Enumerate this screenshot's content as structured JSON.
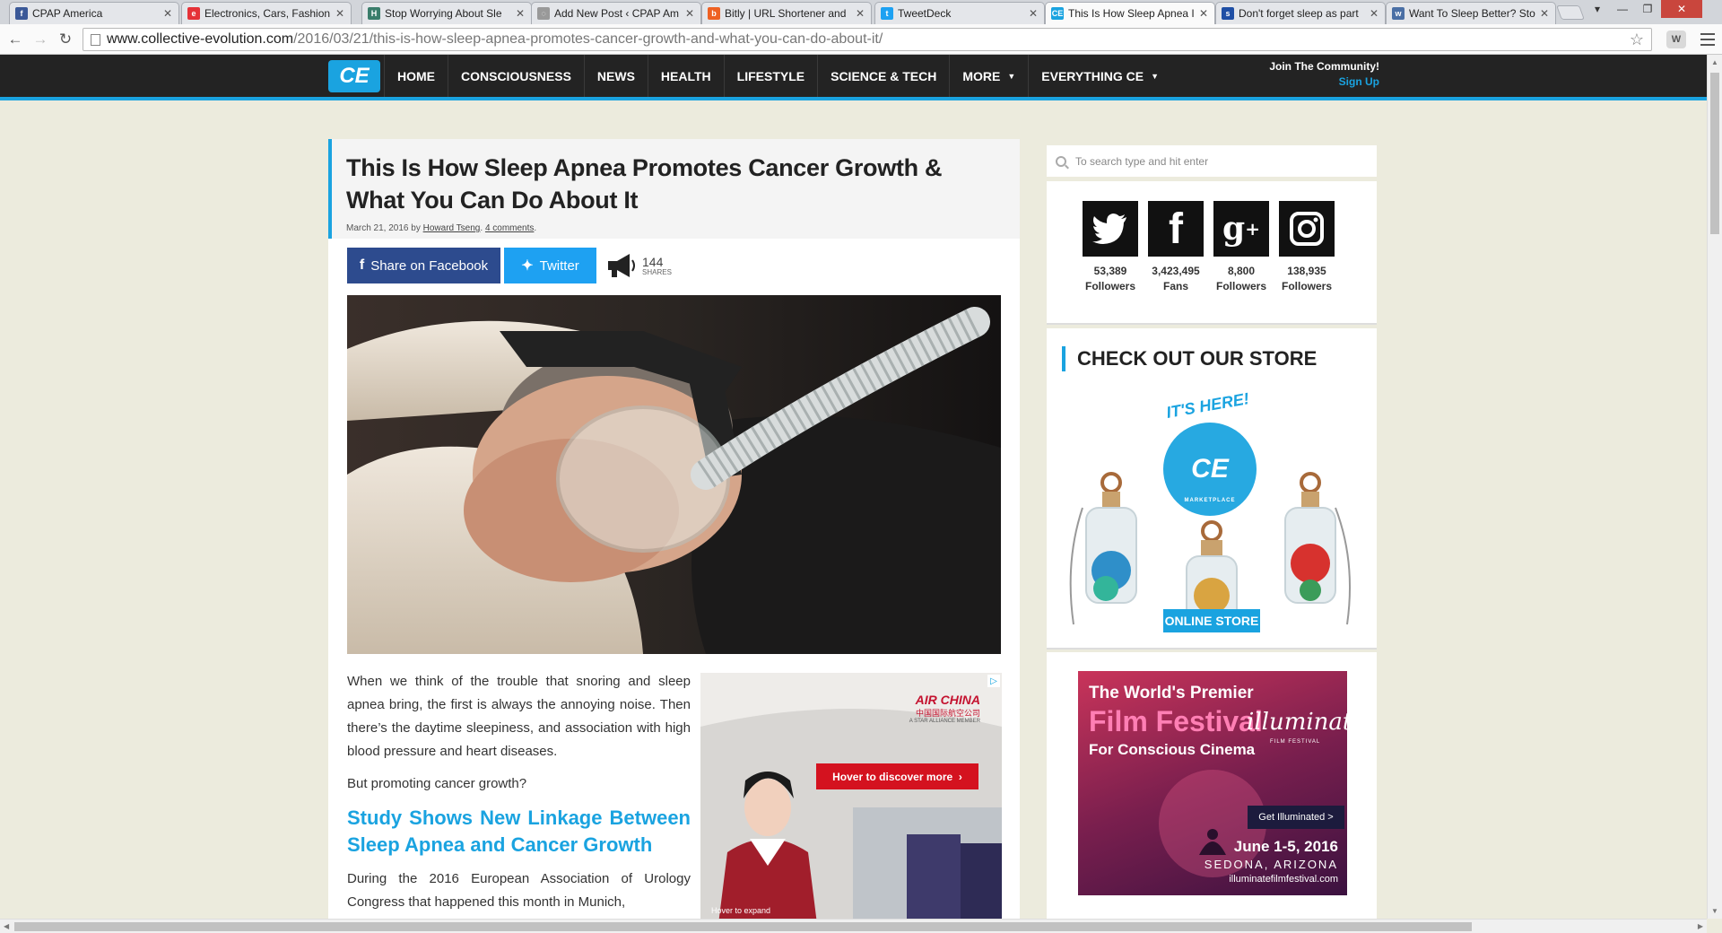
{
  "browser": {
    "tabs": [
      {
        "title": "CPAP America",
        "favicon": "facebook-favicon",
        "color": "#3b5998",
        "glyph": "f"
      },
      {
        "title": "Electronics, Cars, Fashion,",
        "favicon": "ebay-favicon",
        "color": "#e53238",
        "glyph": "e"
      },
      {
        "title": "Stop Worrying About Sle",
        "favicon": "h-favicon",
        "color": "#3a7d6b",
        "glyph": "H"
      },
      {
        "title": "Add New Post ‹ CPAP Am",
        "favicon": "loading-favicon",
        "color": "#999999",
        "glyph": "◌"
      },
      {
        "title": "Bitly | URL Shortener and",
        "favicon": "bitly-favicon",
        "color": "#ee6123",
        "glyph": "b"
      },
      {
        "title": "TweetDeck",
        "favicon": "tweetdeck-favicon",
        "color": "#1da1f2",
        "glyph": "t"
      },
      {
        "title": "This Is How Sleep Apnea I",
        "favicon": "ce-favicon",
        "color": "#1aa3e0",
        "glyph": "CE"
      },
      {
        "title": "Don't forget sleep as part",
        "favicon": "site-favicon",
        "color": "#1f4fa5",
        "glyph": "s"
      },
      {
        "title": "Want To Sleep Better? Sto",
        "favicon": "site2-favicon",
        "color": "#4a6fa5",
        "glyph": "w"
      }
    ],
    "active_tab": 6,
    "url_domain": "www.collective-evolution.com",
    "url_path": "/2016/03/21/this-is-how-sleep-apnea-promotes-cancer-growth-and-what-you-can-do-about-it/",
    "extension_label": "W"
  },
  "site": {
    "logo_text": "CE",
    "nav": [
      "HOME",
      "CONSCIOUSNESS",
      "NEWS",
      "HEALTH",
      "LIFESTYLE",
      "SCIENCE & TECH",
      "MORE",
      "EVERYTHING CE"
    ],
    "join": "Join The Community!",
    "signup": "Sign Up",
    "accent": "#1aa3e0"
  },
  "article": {
    "title": "This Is How Sleep Apnea Promotes Cancer Growth & What You Can Do About It",
    "date": "March 21, 2016",
    "by": "by",
    "author": "Howard Tseng",
    "comments": "4 comments",
    "share_facebook": "Share on Facebook",
    "share_twitter": "Twitter",
    "share_count": "144",
    "share_label": "SHARES",
    "para1": "When we think of the trouble that snoring and sleep apnea bring, the first is always the annoying noise. Then there’s the daytime sleepiness, and association with high blood pressure and heart diseases.",
    "para2": "But promoting cancer growth?",
    "subheading": "Study Shows New Linkage Between Sleep Apnea and Cancer Growth",
    "para3": "During the 2016 European Association of Urology Congress that happened this month in Munich,"
  },
  "ad": {
    "brand": "AIR CHINA",
    "brand_cn": "中国国际航空公司",
    "alliance": "A STAR ALLIANCE MEMBER",
    "cta": "Hover to discover more",
    "hover": "Hover to expand"
  },
  "sidebar": {
    "search_placeholder": "To search type and hit enter",
    "social": [
      {
        "icon": "twitter-icon",
        "count": "53,389",
        "label": "Followers"
      },
      {
        "icon": "facebook-icon",
        "count": "3,423,495",
        "label": "Fans"
      },
      {
        "icon": "googleplus-icon",
        "count": "8,800",
        "label": "Followers"
      },
      {
        "icon": "instagram-icon",
        "count": "138,935",
        "label": "Followers"
      }
    ],
    "store_heading": "CHECK OUT OUR STORE",
    "store_tag": "IT'S HERE!",
    "store_logo": "CE",
    "store_sub": "MARKETPLACE",
    "store_button": "ONLINE STORE",
    "film": {
      "line1": "The World's Premier",
      "line2": "Film Festival",
      "line3": "For Conscious Cinema",
      "brand": "illuminate",
      "brand_sub": "FILM FESTIVAL",
      "cta": "Get Illuminated >",
      "dates": "June 1-5, 2016",
      "place": "SEDONA, ARIZONA",
      "site": "illuminatefilmfestival.com"
    }
  }
}
